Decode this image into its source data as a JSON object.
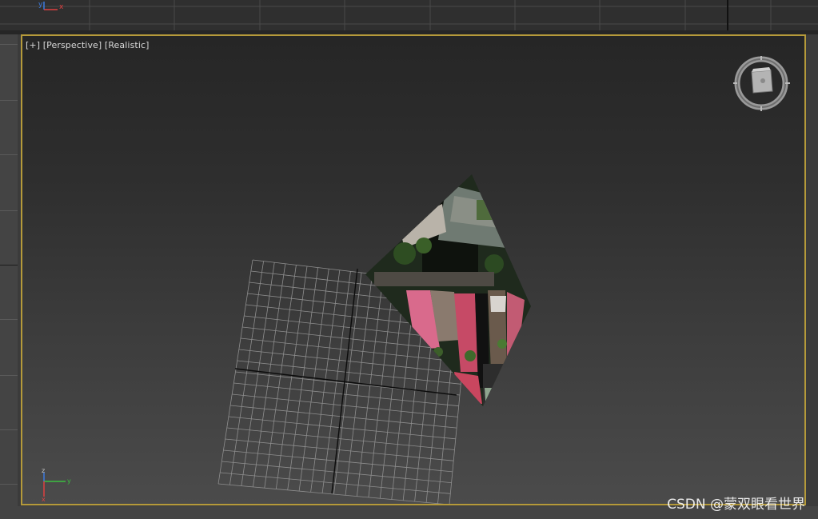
{
  "viewport": {
    "labels": [
      "[+]",
      "[Perspective]",
      "[Realistic]"
    ],
    "active_border_color": "#b59a3a"
  },
  "axis_tripod": {
    "x": "x",
    "y": "y",
    "z": "z"
  },
  "top_view_axis": {
    "x": "x",
    "y": "y"
  },
  "viewcube": {
    "icon": "viewcube-icon"
  },
  "watermark": "CSDN @蒙双眼看世界"
}
